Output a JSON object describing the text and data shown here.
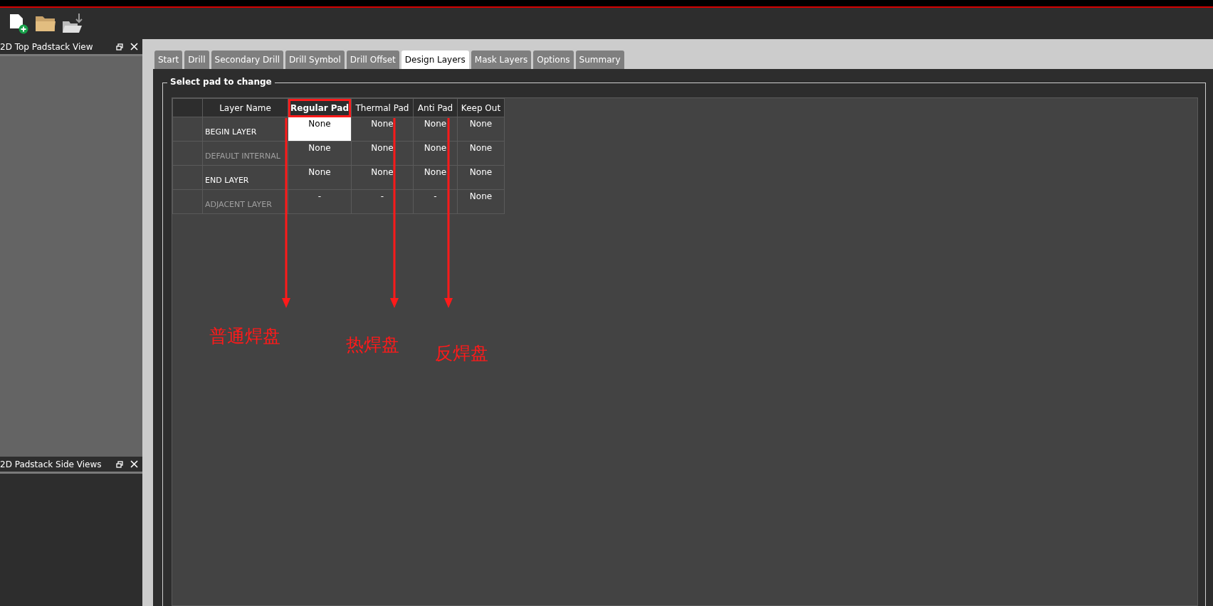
{
  "toolbar": {
    "buttons": [
      {
        "kind": "new"
      },
      {
        "kind": "open"
      },
      {
        "kind": "import"
      }
    ]
  },
  "panels": [
    {
      "title": "2D Top Padstack View",
      "kind": "light"
    },
    {
      "title": "2D Padstack Side Views",
      "kind": "dark"
    }
  ],
  "tabs": [
    {
      "label": "Start",
      "selected": false
    },
    {
      "label": "Drill",
      "selected": false
    },
    {
      "label": "Secondary Drill",
      "selected": false
    },
    {
      "label": "Drill Symbol",
      "selected": false
    },
    {
      "label": "Drill Offset",
      "selected": false
    },
    {
      "label": "Design Layers",
      "selected": true
    },
    {
      "label": "Mask Layers",
      "selected": false
    },
    {
      "label": "Options",
      "selected": false
    },
    {
      "label": "Summary",
      "selected": false
    }
  ],
  "group": {
    "title": "Select pad to change"
  },
  "table": {
    "columns": [
      {
        "label": "Layer Name",
        "highlighted": false
      },
      {
        "label": "Regular Pad",
        "highlighted": true
      },
      {
        "label": "Thermal Pad",
        "highlighted": false
      },
      {
        "label": "Anti Pad",
        "highlighted": false
      },
      {
        "label": "Keep Out",
        "highlighted": false
      }
    ],
    "rows": [
      {
        "cells": [
          {
            "value": "BEGIN LAYER",
            "disabled": false
          },
          {
            "value": "None",
            "selected": true
          },
          {
            "value": "None",
            "selected": false
          },
          {
            "value": "None",
            "selected": false
          },
          {
            "value": "None",
            "selected": false
          }
        ]
      },
      {
        "cells": [
          {
            "value": "DEFAULT INTERNAL",
            "disabled": true
          },
          {
            "value": "None",
            "selected": false
          },
          {
            "value": "None",
            "selected": false
          },
          {
            "value": "None",
            "selected": false
          },
          {
            "value": "None",
            "selected": false
          }
        ]
      },
      {
        "cells": [
          {
            "value": "END LAYER",
            "disabled": false
          },
          {
            "value": "None",
            "selected": false
          },
          {
            "value": "None",
            "selected": false
          },
          {
            "value": "None",
            "selected": false
          },
          {
            "value": "None",
            "selected": false
          }
        ]
      },
      {
        "cells": [
          {
            "value": "ADJACENT LAYER",
            "disabled": true
          },
          {
            "value": "-",
            "selected": false
          },
          {
            "value": "-",
            "selected": false
          },
          {
            "value": "-",
            "selected": false
          },
          {
            "value": "None",
            "selected": false
          }
        ]
      }
    ]
  },
  "annotations": [
    {
      "label": "普通焊盘"
    },
    {
      "label": "热焊盘"
    },
    {
      "label": "反焊盘"
    }
  ]
}
